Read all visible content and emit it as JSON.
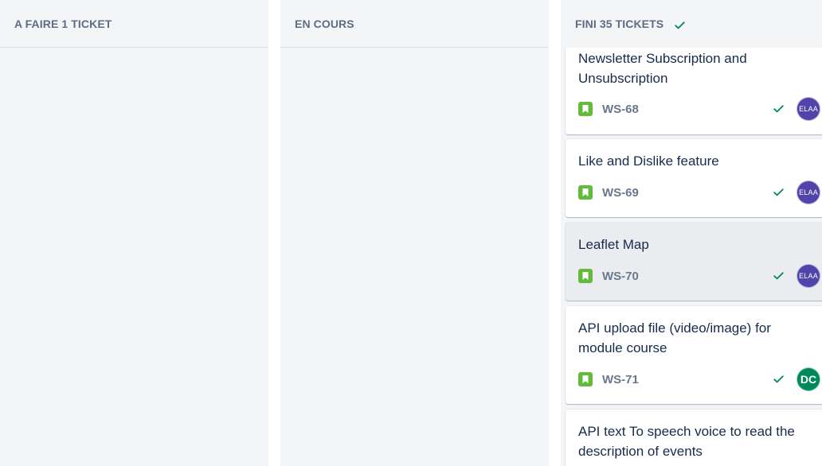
{
  "columns": {
    "todo": {
      "title": "A FAIRE 1 TICKET"
    },
    "in_progress": {
      "title": "EN COURS"
    },
    "done": {
      "title": "FINI 35 TICKETS",
      "done_icon": "check-icon"
    }
  },
  "cards": [
    {
      "title": "Newsletter Subscription and Unsubscription",
      "key": "WS-68",
      "type_icon": "story-icon",
      "status_icon": "check-icon",
      "avatar": {
        "initials": "ELAA",
        "color": "#5243aa"
      }
    },
    {
      "title": "Like and Dislike feature",
      "key": "WS-69",
      "type_icon": "story-icon",
      "status_icon": "check-icon",
      "avatar": {
        "initials": "ELAA",
        "color": "#5243aa"
      }
    },
    {
      "title": "Leaflet Map",
      "key": "WS-70",
      "type_icon": "story-icon",
      "status_icon": "check-icon",
      "avatar": {
        "initials": "ELAA",
        "color": "#5243aa"
      }
    },
    {
      "title": "API upload file (video/image) for module course",
      "key": "WS-71",
      "type_icon": "story-icon",
      "status_icon": "check-icon",
      "avatar": {
        "initials": "DC",
        "color": "#00875a"
      }
    },
    {
      "title": "API text To speech voice to read the description of events"
    }
  ],
  "colors": {
    "column_bg": "#f4f5f7",
    "story_green": "#63ba3c",
    "done_check_green": "#00875a",
    "muted_text": "#5e6c84"
  }
}
